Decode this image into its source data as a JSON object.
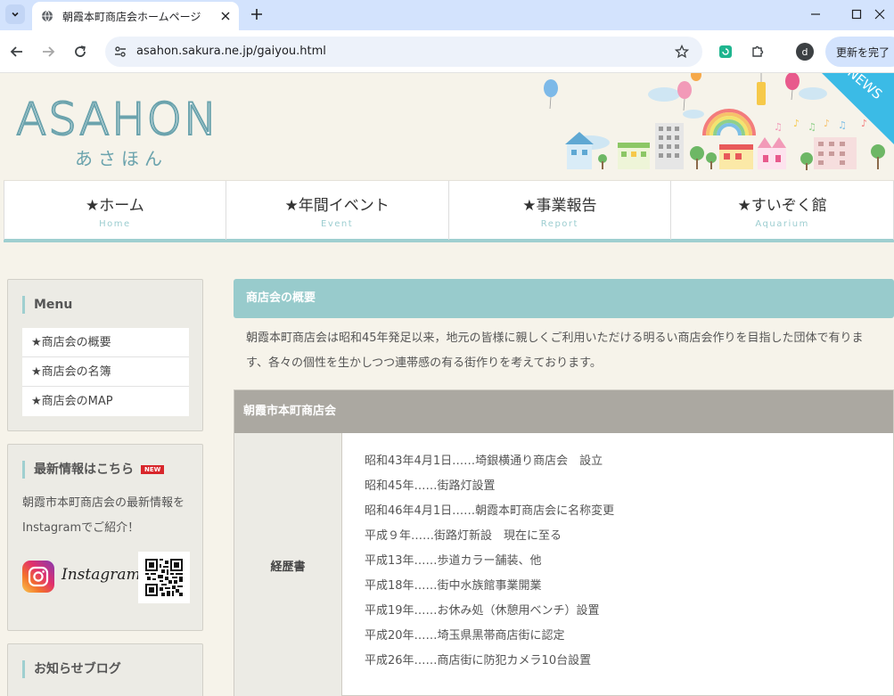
{
  "browser": {
    "tab_title": "朝霞本町商店会ホームページ",
    "url": "asahon.sakura.ne.jp/gaiyou.html",
    "profile_initial": "d",
    "update_label": "更新を完了"
  },
  "site": {
    "logo_text": "ASAHON",
    "logo_kana": "あさほん",
    "news_banner": "NEWS"
  },
  "nav": [
    {
      "label": "★ホーム",
      "sub": "Home"
    },
    {
      "label": "★年間イベント",
      "sub": "Event"
    },
    {
      "label": "★事業報告",
      "sub": "Report"
    },
    {
      "label": "★すいぞく館",
      "sub": "Aquarium"
    }
  ],
  "sidebar": {
    "menu_title": "Menu",
    "menu_items": [
      "★商店会の概要",
      "★商店会の名簿",
      "★商店会のMAP"
    ],
    "news_title": "最新情報はこちら",
    "new_badge": "NEW",
    "news_text": "朝霞市本町商店会の最新情報をInstagramでご紹介！",
    "instagram_label": "Instagram",
    "blog_title": "お知らせブログ"
  },
  "main": {
    "section_title": "商店会の概要",
    "intro": "朝霞本町商店会は昭和45年発足以来，地元の皆様に親しくご利用いただける明るい商店会作りを目指した団体で有ります、各々の個性を生かしつつ連帯感の有る街作りを考えております。",
    "table_title": "朝霞市本町商店会",
    "row_label": "経歴書",
    "history": [
      "昭和43年4月1日……埼銀横通り商店会　設立",
      "昭和45年……街路灯設置",
      "昭和46年4月1日……朝霞本町商店会に名称変更",
      "平成９年……街路灯新設　現在に至る",
      "平成13年……歩道カラー舗装、他",
      "平成18年……街中水族館事業開業",
      "平成19年……お休み処（休憩用ベンチ）設置",
      "平成20年……埼玉県黒帯商店街に認定",
      "平成26年……商店街に防犯カメラ10台設置"
    ]
  },
  "colors": {
    "accent": "#98cbcc",
    "logo": "#6ba3ad",
    "background": "#f6f3ea",
    "table_head": "#aba8a1"
  }
}
